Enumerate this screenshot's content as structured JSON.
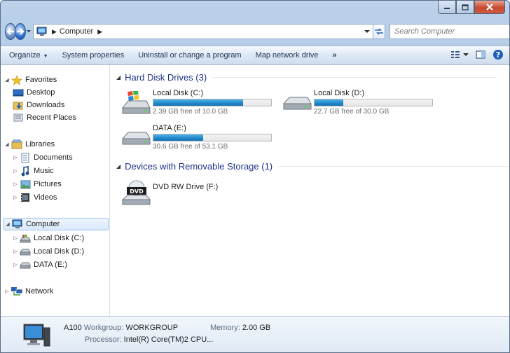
{
  "window": {
    "title": "Computer",
    "caption_buttons": [
      "minimize",
      "maximize",
      "close"
    ]
  },
  "address": {
    "crumbs": [
      "Computer"
    ],
    "search_placeholder": "Search Computer"
  },
  "toolbar": {
    "organize": "Organize",
    "system_properties": "System properties",
    "uninstall": "Uninstall or change a program",
    "map_drive": "Map network drive",
    "more": "»"
  },
  "nav": {
    "favorites": "Favorites",
    "desktop": "Desktop",
    "downloads": "Downloads",
    "recent_places": "Recent Places",
    "libraries": "Libraries",
    "documents": "Documents",
    "music": "Music",
    "pictures": "Pictures",
    "videos": "Videos",
    "computer": "Computer",
    "local_c": "Local Disk (C:)",
    "local_d": "Local Disk (D:)",
    "data_e": "DATA (E:)",
    "network": "Network"
  },
  "main": {
    "hdd_header": "Hard Disk Drives (3)",
    "removable_header": "Devices with Removable Storage (1)",
    "drives": [
      {
        "name": "Local Disk (C:)",
        "free": "2.39 GB free of 10.0 GB",
        "used_fraction": 0.761
      },
      {
        "name": "Local Disk (D:)",
        "free": "22.7 GB free of 30.0 GB",
        "used_fraction": 0.243
      },
      {
        "name": "DATA (E:)",
        "free": "30.6 GB free of 53.1 GB",
        "used_fraction": 0.424
      }
    ],
    "dvd": {
      "name": "DVD RW Drive (F:)",
      "icon_label": "DVD"
    }
  },
  "details": {
    "name": "A100",
    "workgroup_label": "Workgroup:",
    "workgroup": "WORKGROUP",
    "memory_label": "Memory:",
    "memory": "2.00 GB",
    "processor_label": "Processor:",
    "processor": "Intel(R) Core(TM)2 CPU..."
  },
  "colors": {
    "bar_fill": "#1f86c8",
    "header_text": "#1e3287",
    "close_button": "#c74a30"
  }
}
